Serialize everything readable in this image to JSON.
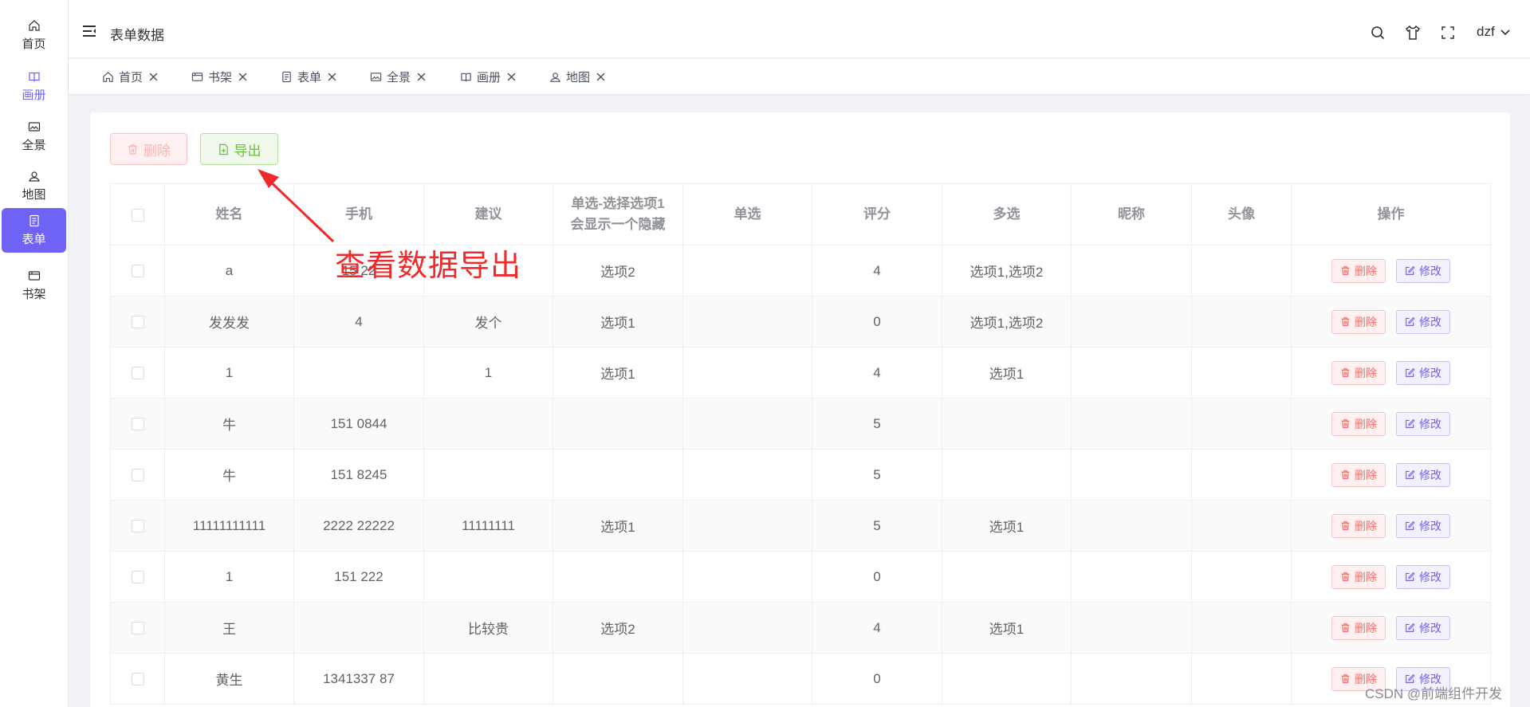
{
  "sidebar": {
    "items": [
      {
        "label": "首页",
        "icon": "home-icon",
        "state": "normal"
      },
      {
        "label": "画册",
        "icon": "album-icon",
        "state": "violet"
      },
      {
        "label": "全景",
        "icon": "panorama-icon",
        "state": "normal"
      },
      {
        "label": "地图",
        "icon": "map-pin-icon",
        "state": "normal"
      },
      {
        "label": "表单",
        "icon": "form-icon",
        "state": "active"
      },
      {
        "label": "书架",
        "icon": "bookshelf-icon",
        "state": "normal"
      }
    ]
  },
  "header": {
    "title": "表单数据",
    "user": "dzf"
  },
  "tabs": [
    {
      "label": "首页",
      "icon": "home-icon"
    },
    {
      "label": "书架",
      "icon": "bookshelf-icon"
    },
    {
      "label": "表单",
      "icon": "form-icon"
    },
    {
      "label": "全景",
      "icon": "panorama-icon"
    },
    {
      "label": "画册",
      "icon": "album-icon"
    },
    {
      "label": "地图",
      "icon": "map-pin-icon"
    }
  ],
  "toolbar": {
    "delete_label": "删除",
    "export_label": "导出"
  },
  "table": {
    "headers": [
      "姓名",
      "手机",
      "建议",
      "单选-选择选项1会显示一个隐藏",
      "单选",
      "评分",
      "多选",
      "昵称",
      "头像",
      "操作"
    ],
    "header_multiline_1": "单选-选择选项1",
    "header_multiline_2": "会显示一个隐藏",
    "row_delete_label": "删除",
    "row_edit_label": "修改",
    "rows": [
      {
        "name": "a",
        "phone": "15    22",
        "suggest": "",
        "radio_hidden": "选项2",
        "radio": "",
        "score": "4",
        "multi": "选项1,选项2"
      },
      {
        "name": "发发发",
        "phone": "4",
        "suggest": "发个",
        "radio_hidden": "选项1",
        "radio": "",
        "score": "0",
        "multi": "选项1,选项2"
      },
      {
        "name": "1",
        "phone": "",
        "suggest": "1",
        "radio_hidden": "选项1",
        "radio": "",
        "score": "4",
        "multi": "选项1"
      },
      {
        "name": "牛",
        "phone": "151    0844",
        "suggest": "",
        "radio_hidden": "",
        "radio": "",
        "score": "5",
        "multi": ""
      },
      {
        "name": "牛",
        "phone": "151    8245",
        "suggest": "",
        "radio_hidden": "",
        "radio": "",
        "score": "5",
        "multi": ""
      },
      {
        "name": "11111111111",
        "phone": "2222    22222",
        "suggest": "11111111",
        "radio_hidden": "选项1",
        "radio": "",
        "score": "5",
        "multi": "选项1"
      },
      {
        "name": "1",
        "phone": "151    222",
        "suggest": "",
        "radio_hidden": "",
        "radio": "",
        "score": "0",
        "multi": ""
      },
      {
        "name": "王",
        "phone": "",
        "suggest": "比较贵",
        "radio_hidden": "选项2",
        "radio": "",
        "score": "4",
        "multi": "选项1"
      },
      {
        "name": "黄生",
        "phone": "1341337    87",
        "suggest": "",
        "radio_hidden": "",
        "radio": "",
        "score": "0",
        "multi": ""
      }
    ]
  },
  "annotation": {
    "text": "查看数据导出",
    "color": "#f02a2a"
  },
  "watermark": "CSDN @前端组件开发",
  "colors": {
    "primary": "#6f63f5",
    "danger": "#f56c6c",
    "success": "#67c23a"
  }
}
